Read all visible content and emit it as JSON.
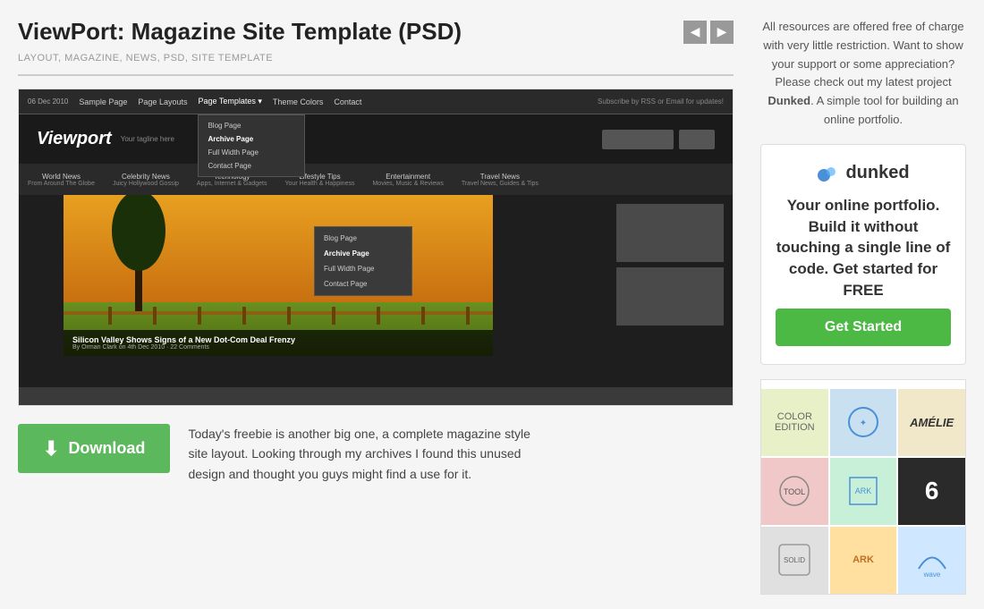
{
  "post": {
    "title": "ViewPort: Magazine Site Template (PSD)",
    "tags": "LAYOUT, MAGAZINE, NEWS, PSD, SITE TEMPLATE",
    "description_line1": "Today's freebie is another big one, a complete magazine style",
    "description_line2": "site layout. Looking through my archives I found this unused",
    "description_line3": "design and thought you guys might find a use for it."
  },
  "nav_arrows": {
    "prev": "◀",
    "next": "▶"
  },
  "download": {
    "label": "Download",
    "icon": "⬇"
  },
  "sidebar": {
    "intro_text": "All resources are offered free of charge with very little restriction. Want to show your support or some appreciation? Please check out my latest project ",
    "project_name": "Dunked",
    "intro_text2": ". A simple tool for building an online portfolio.",
    "dunked_brand": "dunked",
    "card_title": "Your online portfolio. Build it without touching a single line of code. Get started for FREE",
    "get_started": "Get Started"
  },
  "mock_screenshot": {
    "date": "06 Dec 2010",
    "nav_items": [
      "Sample Page",
      "Page Layouts",
      "Page Templates",
      "Theme Colors",
      "Contact"
    ],
    "subscribe_text": "Subscribe by RSS or Email for updates!",
    "dropdown_items": [
      "Blog Page",
      "Archive Page",
      "Full Width Page",
      "Contact Page"
    ],
    "logo": "Viewport",
    "tagline": "Your tagline here",
    "categories": [
      "World News",
      "Celebrity News",
      "Technology",
      "Lifestyle Tips",
      "Entertainment",
      "Travel News"
    ],
    "hero_title": "Silicon Valley Shows Signs of a New Dot-Com Deal Frenzy",
    "hero_meta": "By Orman Clark on 4th Dec 2010 · 22 Comments",
    "ent_dropdown": [
      "Blog Page",
      "Archive Page",
      "Full Width Page",
      "Contact Page"
    ]
  },
  "portfolio_cells": [
    {
      "label": "COLOR",
      "bg": "#e8f0c8"
    },
    {
      "label": "",
      "bg": "#c8e0f0"
    },
    {
      "label": "AMÉLIE",
      "bg": "#f0e8c8"
    },
    {
      "label": "",
      "bg": "#f0c8c8"
    },
    {
      "label": "",
      "bg": "#c8f0d8"
    },
    {
      "label": "6",
      "bg": "#2a2a2a"
    },
    {
      "label": "",
      "bg": "#e0e0e0"
    },
    {
      "label": "ARK",
      "bg": "#ffe0a0"
    },
    {
      "label": "",
      "bg": "#d0e8ff"
    }
  ]
}
